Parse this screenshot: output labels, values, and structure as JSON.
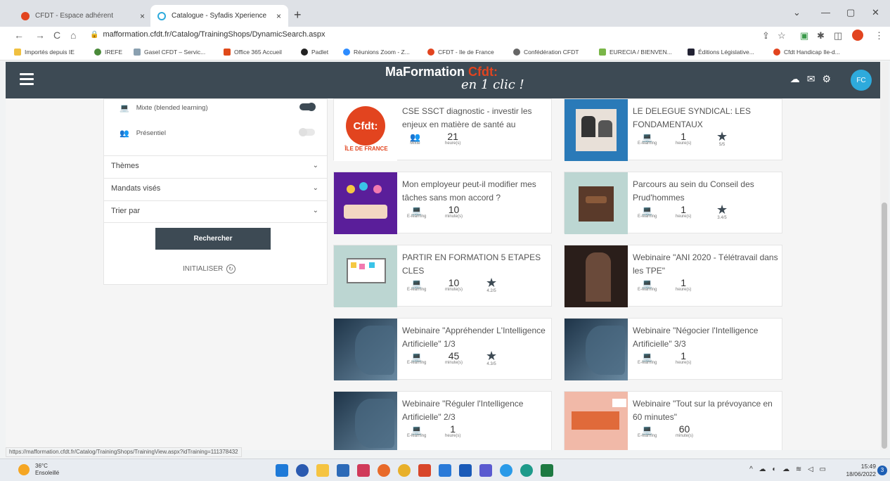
{
  "browser": {
    "tabs": [
      {
        "label": "CFDT - Espace adhérent",
        "close": "×"
      },
      {
        "label": "Catalogue - Syfadis Xperience",
        "close": "×"
      }
    ],
    "new_tab": "+",
    "window_controls": [
      "⌄",
      "—",
      "▢",
      "✕"
    ],
    "nav": {
      "back": "←",
      "forward": "→",
      "reload": "C",
      "home": "⌂"
    },
    "url": "mafformation.cfdt.fr/Catalog/TrainingShops/DynamicSearch.aspx",
    "bookmarks": [
      "Importés depuis IE",
      "IREFE",
      "Gasel CFDT – Servic...",
      "Office 365 Accueil",
      "Padlet",
      "Réunions Zoom - Z...",
      "CFDT - Ile de France",
      "Confédération CFDT",
      "EURECIA / BIENVEN...",
      "Éditions Législative...",
      "Cfdt Handicap Ile-d..."
    ]
  },
  "header": {
    "logo_text": "MaFormation",
    "logo_brand": "Cfdt:",
    "slogan": "en 1 clic !",
    "avatar": "FC"
  },
  "filters": {
    "modalities": [
      {
        "label": "Mixte (blended learning)",
        "on": true
      },
      {
        "label": "Présentiel",
        "on": false
      }
    ],
    "dropdowns": [
      "Thèmes",
      "Mandats visés",
      "Trier par"
    ],
    "search_label": "Rechercher",
    "reset_label": "INITIALISER"
  },
  "cards": [
    {
      "title": "CSE SSCT diagnostic - investir les enjeux en matière de santé au",
      "mode": "Mixte",
      "duration": "21",
      "unit": "heure(s)",
      "rating": "",
      "thumb_text": "Cfdt:",
      "thumb_sub": "ÎLE DE FRANCE"
    },
    {
      "title": "LE DELEGUE SYNDICAL: LES FONDAMENTAUX",
      "mode": "E-learning",
      "duration": "1",
      "unit": "heure(s)",
      "rating": "5/5"
    },
    {
      "title": "Mon employeur peut-il modifier mes tâches sans mon accord ?",
      "mode": "E-learning",
      "duration": "10",
      "unit": "minute(s)",
      "rating": ""
    },
    {
      "title": "Parcours au sein du Conseil des Prud'hommes",
      "mode": "E-learning",
      "duration": "1",
      "unit": "heure(s)",
      "rating": "3.4/5"
    },
    {
      "title": "PARTIR EN FORMATION 5 ETAPES CLES",
      "mode": "E-learning",
      "duration": "10",
      "unit": "minute(s)",
      "rating": "4.2/5"
    },
    {
      "title": "Webinaire \"ANI 2020 - Télétravail dans les TPE\"",
      "mode": "E-learning",
      "duration": "1",
      "unit": "heure(s)",
      "rating": ""
    },
    {
      "title": "Webinaire \"Appréhender L'Intelligence Artificielle\" 1/3",
      "mode": "E-learning",
      "duration": "45",
      "unit": "minute(s)",
      "rating": "4.3/5"
    },
    {
      "title": "Webinaire \"Négocier l'Intelligence Artificielle\" 3/3",
      "mode": "E-learning",
      "duration": "1",
      "unit": "heure(s)",
      "rating": ""
    },
    {
      "title": "Webinaire \"Réguler l'Intelligence Artificielle\" 2/3",
      "mode": "E-learning",
      "duration": "1",
      "unit": "heure(s)",
      "rating": ""
    },
    {
      "title": "Webinaire \"Tout sur la prévoyance en 60 minutes\"",
      "mode": "E-learning",
      "duration": "60",
      "unit": "minute(s)",
      "rating": ""
    }
  ],
  "status_url": "https://mafformation.cfdt.fr/Catalog/TrainingShops/TrainingView.aspx?idTraining=111378432",
  "taskbar": {
    "temp": "36°C",
    "weather": "Ensoleillé",
    "time": "15:49",
    "date": "18/06/2022",
    "notifications": "3"
  },
  "colors": {
    "header": "#3d4a54",
    "brand_orange": "#e2441f",
    "avatar": "#2eaadc"
  }
}
